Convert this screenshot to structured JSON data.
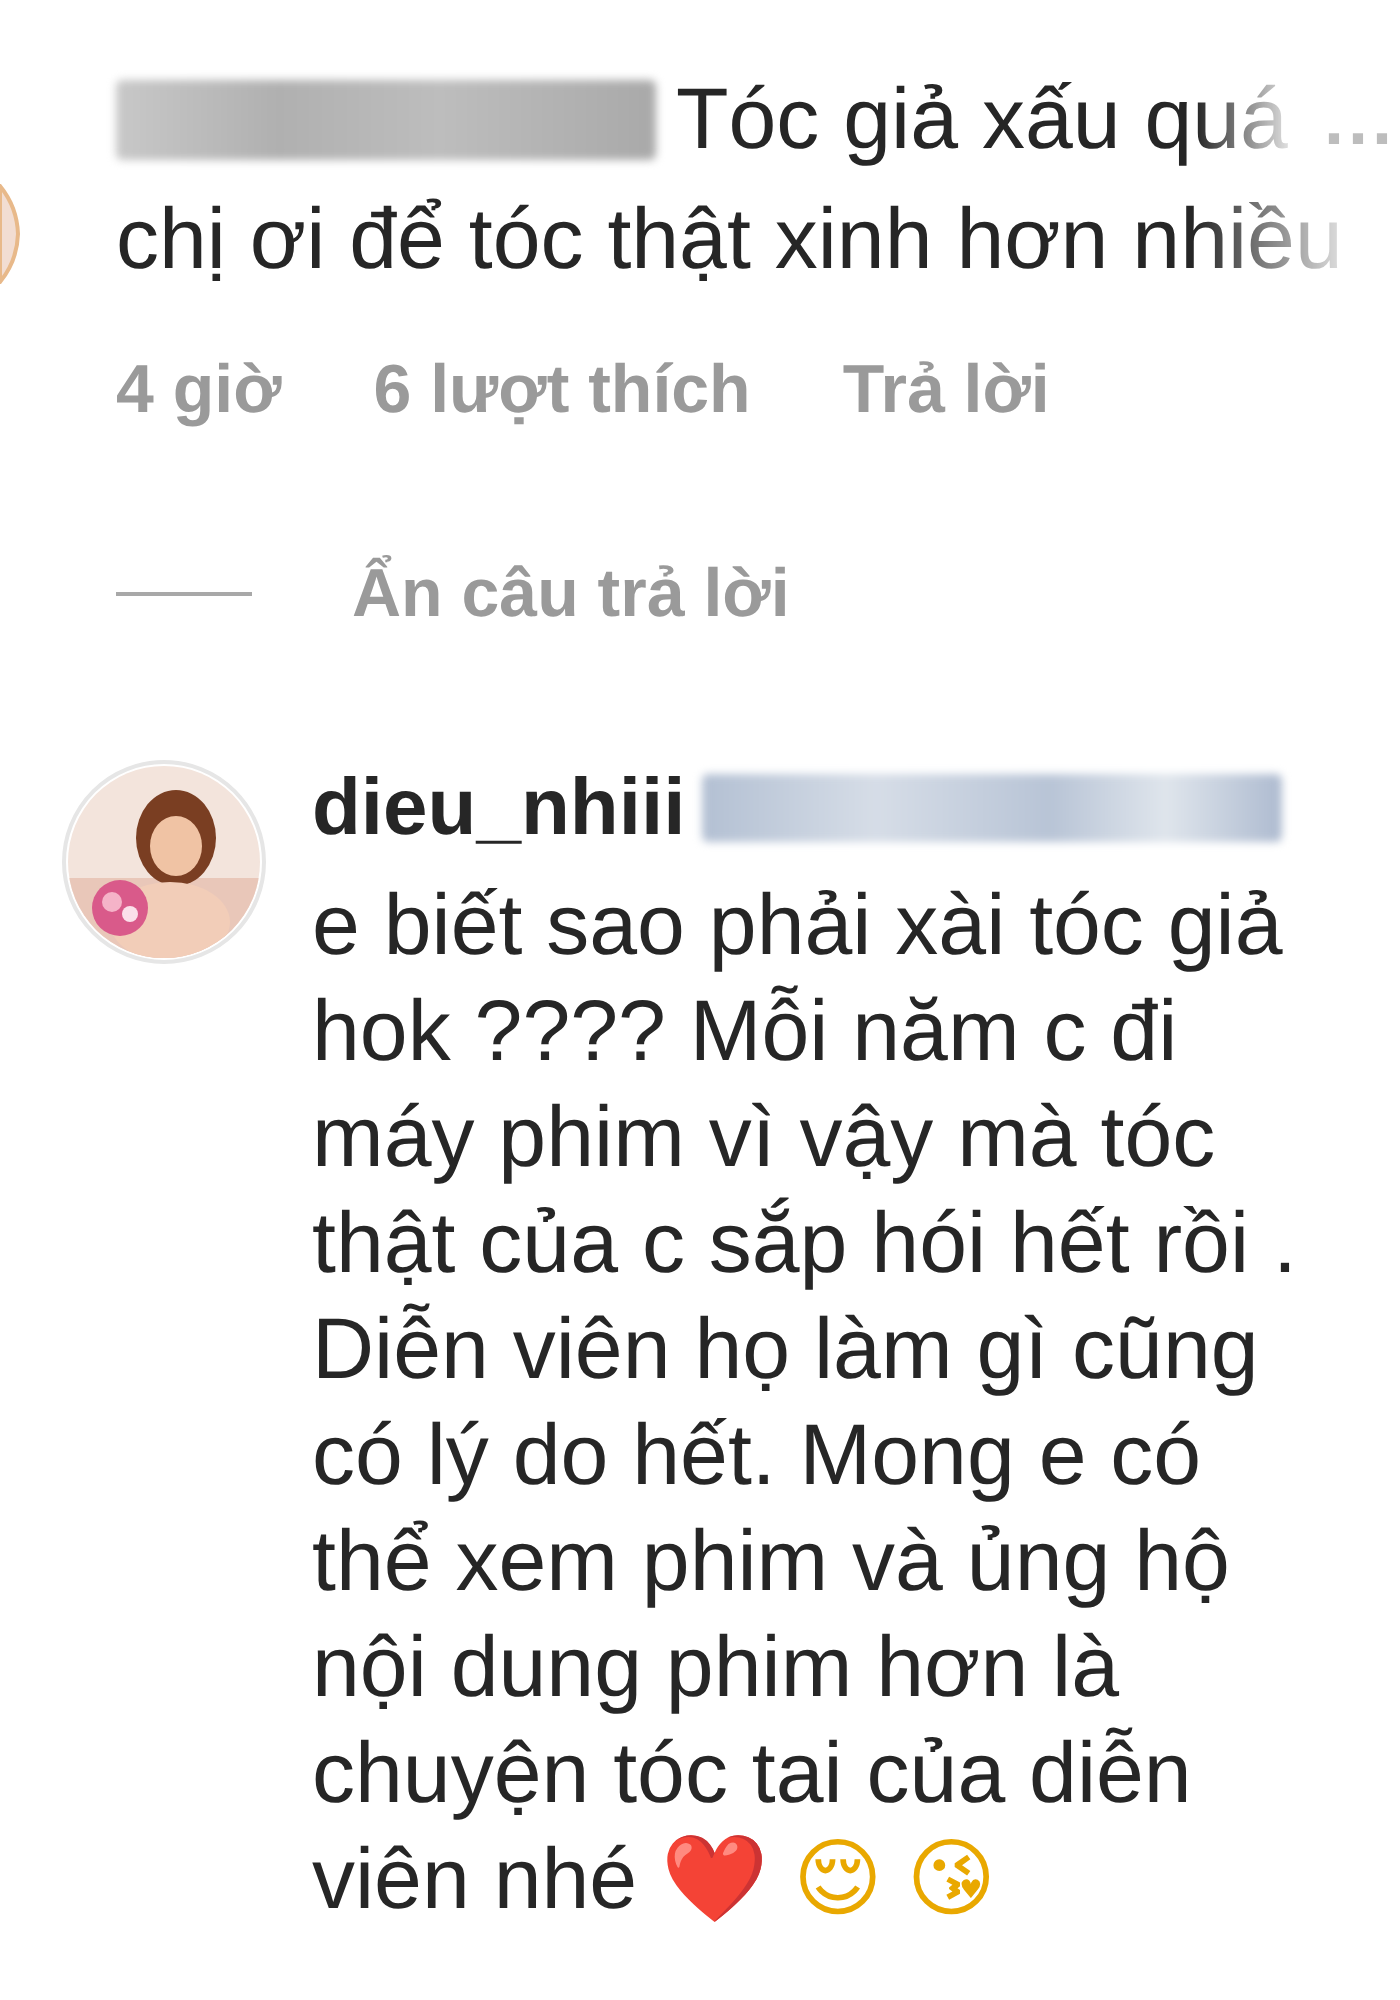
{
  "comments": [
    {
      "username_hidden": true,
      "text": "Tóc giả xấu quá",
      "text_cont": "chị ơi để tóc thật xinh hơn nhiều",
      "more": "...",
      "time": "4 giờ",
      "likes": "6 lượt thích",
      "reply": "Trả lời",
      "hide_replies": "Ẩn câu trả lời"
    },
    {
      "username": "dieu_nhiii",
      "username_suffix_hidden": true,
      "text": "e biết sao phải xài tóc giả hok ???? Mỗi năm c đi máy phim vì vậy mà tóc thật của c sắp hói hết rồi . Diễn viên họ làm gì cũng có lý do hết. Mong e có thể xem phim và ủng hộ nội dung phim hơn là chuyện tóc tai của diễn viên nhé ❤️ 😌 😘"
    }
  ]
}
